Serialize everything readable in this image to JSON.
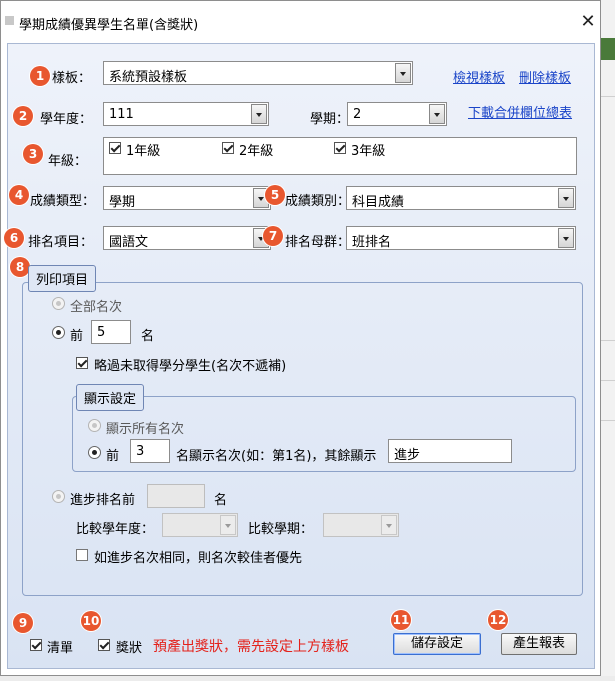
{
  "window": {
    "title": "學期成績優異學生名單(含獎狀)"
  },
  "template": {
    "label": "樣板：",
    "value": "系統預設樣板",
    "view_link": "檢視樣板",
    "delete_link": "刪除樣板"
  },
  "school_year": {
    "label": "學年度：",
    "value": "111"
  },
  "semester": {
    "label": "學期：",
    "value": "2"
  },
  "download_link": "下載合併欄位總表",
  "grade": {
    "label": "年級：",
    "items": [
      {
        "label": "1年級",
        "checked": true
      },
      {
        "label": "2年級",
        "checked": true
      },
      {
        "label": "3年級",
        "checked": true
      }
    ]
  },
  "score_type": {
    "label": "成績類型：",
    "value": "學期"
  },
  "score_category": {
    "label": "成績類別：",
    "value": "科目成績"
  },
  "rank_item": {
    "label": "排名項目：",
    "value": "國語文"
  },
  "rank_group": {
    "label": "排名母群：",
    "value": "班排名"
  },
  "print_items": {
    "title": "列印項目",
    "all_ranks": "全部名次",
    "top_label": "前",
    "top_value": "5",
    "top_unit": "名",
    "skip_no_credit": "略過未取得學分學生(名次不遞補)",
    "display": {
      "title": "顯示設定",
      "show_all": "顯示所有名次",
      "top_label": "前",
      "top_value": "3",
      "rank_text": "名顯示名次(如：第1名)，其餘顯示",
      "other_text": "進步"
    },
    "progress_top": "進步排名前",
    "progress_unit": "名",
    "compare_year": "比較學年度：",
    "compare_semester": "比較學期：",
    "tie_break": "如進步名次相同，則名次較佳者優先"
  },
  "footer": {
    "list_label": "清單",
    "award_label": "獎狀",
    "note": "預產出獎狀，需先設定上方樣板",
    "save_button": "儲存設定",
    "generate_button": "產生報表"
  },
  "badges": [
    "1",
    "2",
    "3",
    "4",
    "5",
    "6",
    "7",
    "8",
    "9",
    "10",
    "11",
    "12"
  ],
  "colors": {
    "badge": "#e8572f",
    "link": "#1a44c8",
    "note": "#e4221b",
    "panel": "#dfe7f5"
  }
}
